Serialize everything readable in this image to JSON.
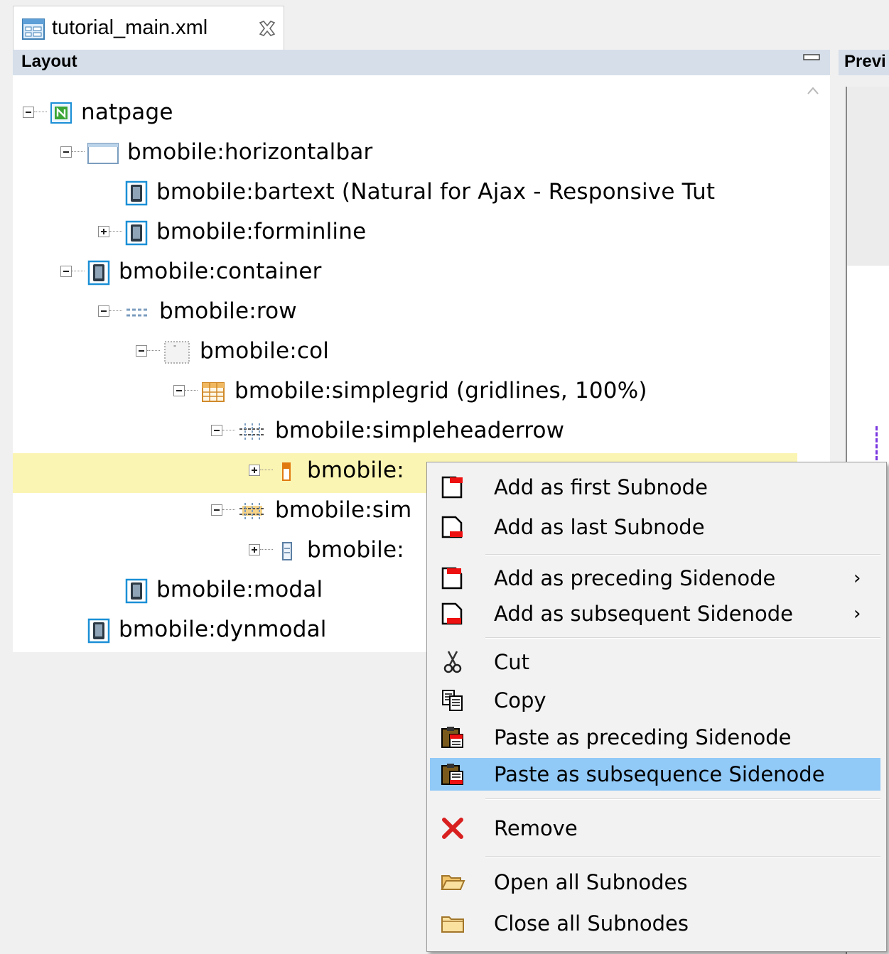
{
  "editor": {
    "tab_title": "tutorial_main.xml"
  },
  "layout_panel": {
    "title": "Layout",
    "tree": [
      {
        "label": "natpage",
        "expander": "minus",
        "icon": "natpage-icon"
      },
      {
        "label": "bmobile:horizontalbar",
        "expander": "minus",
        "icon": "horizontalbar-icon"
      },
      {
        "label": "bmobile:bartext (Natural for Ajax - Responsive Tut",
        "expander": "none",
        "icon": "phone-icon"
      },
      {
        "label": "bmobile:forminline",
        "expander": "plus",
        "icon": "phone-icon"
      },
      {
        "label": "bmobile:container",
        "expander": "minus",
        "icon": "phone-icon"
      },
      {
        "label": "bmobile:row",
        "expander": "minus",
        "icon": "row-icon"
      },
      {
        "label": "bmobile:col",
        "expander": "minus",
        "icon": "col-icon"
      },
      {
        "label": "bmobile:simplegrid (gridlines, 100%)",
        "expander": "minus",
        "icon": "grid-icon"
      },
      {
        "label": "bmobile:simpleheaderrow",
        "expander": "minus",
        "icon": "headerrow-icon"
      },
      {
        "label": "bmobile:",
        "expander": "plus",
        "icon": "headercell-icon",
        "selected": true
      },
      {
        "label": "bmobile:sim",
        "expander": "minus",
        "icon": "simplerow-icon"
      },
      {
        "label": "bmobile:",
        "expander": "plus",
        "icon": "cell-icon"
      },
      {
        "label": "bmobile:modal",
        "expander": "none",
        "icon": "phone-icon"
      },
      {
        "label": "bmobile:dynmodal",
        "expander": "none",
        "icon": "phone-icon"
      }
    ]
  },
  "preview_panel": {
    "title": "Previ"
  },
  "context_menu": {
    "items": [
      {
        "label": "Add as first Subnode",
        "icon": "add-first-subnode-icon"
      },
      {
        "label": "Add as last Subnode",
        "icon": "add-last-subnode-icon"
      },
      {
        "label": "Add as preceding Sidenode",
        "icon": "add-preceding-sidenode-icon",
        "submenu": true
      },
      {
        "label": "Add as subsequent Sidenode",
        "icon": "add-subsequent-sidenode-icon",
        "submenu": true
      },
      {
        "label": "Cut",
        "icon": "scissors-icon"
      },
      {
        "label": "Copy",
        "icon": "copy-icon"
      },
      {
        "label": "Paste as preceding Sidenode",
        "icon": "paste-preceding-icon"
      },
      {
        "label": "Paste as subsequence Sidenode",
        "icon": "paste-subsequent-icon",
        "highlighted": true
      },
      {
        "label": "Remove",
        "icon": "remove-icon"
      },
      {
        "label": "Open all Subnodes",
        "icon": "folder-open-icon"
      },
      {
        "label": "Close all Subnodes",
        "icon": "folder-closed-icon"
      }
    ],
    "submenu_arrow": "›"
  },
  "colors": {
    "panel_header": "#d5dee9",
    "selection_row": "#fbf5b3",
    "menu_highlight": "#91c9f7",
    "icon_blue": "#1a8fd6",
    "marker_red": "#ee1111"
  }
}
